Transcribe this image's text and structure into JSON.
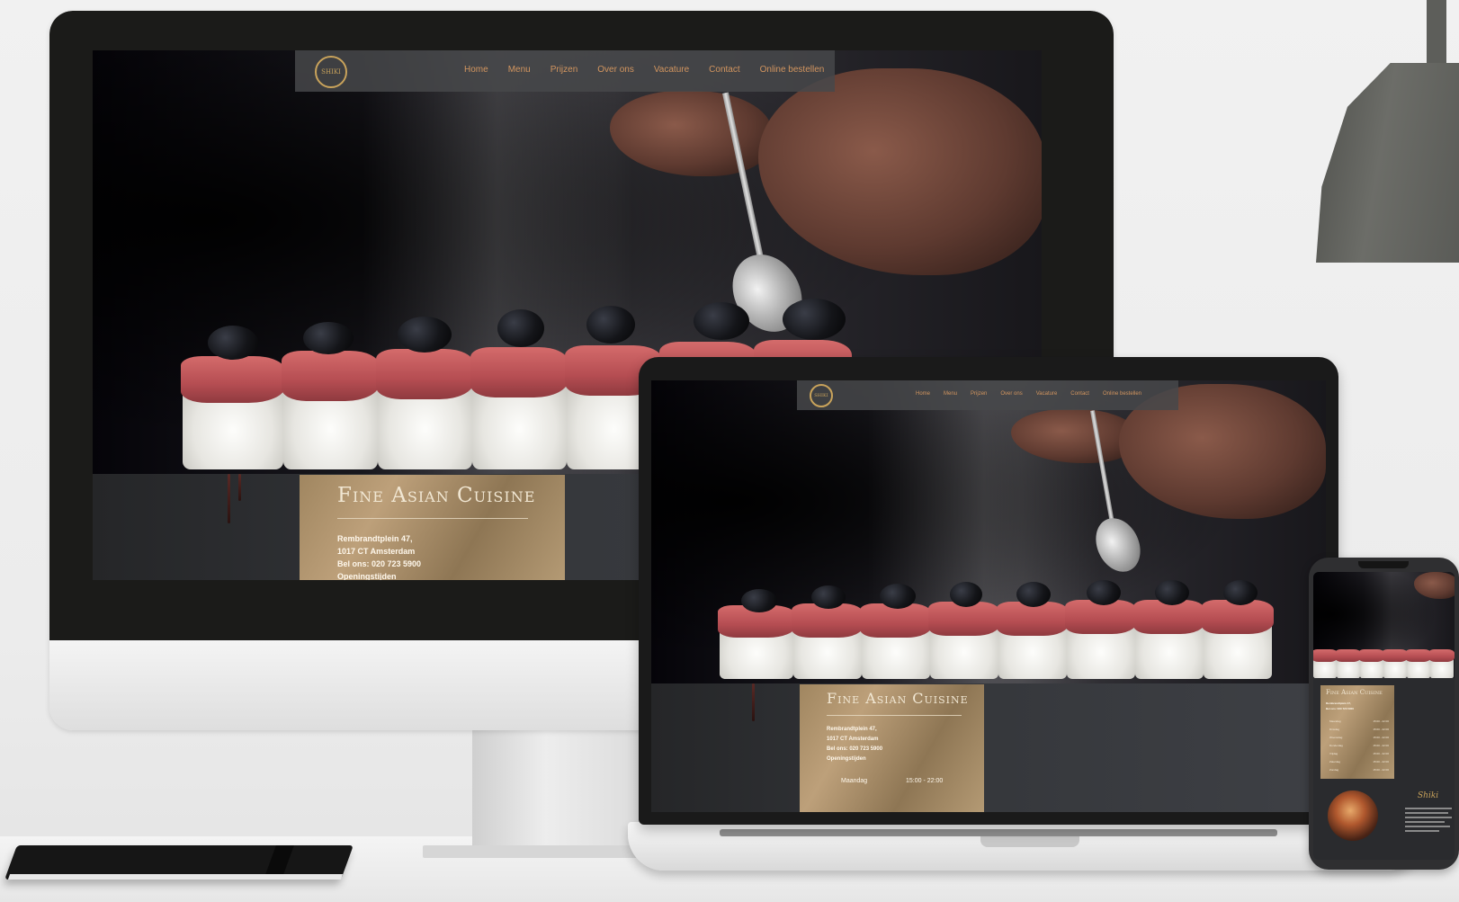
{
  "site": {
    "logo_text": "SHIKI",
    "nav": [
      "Home",
      "Menu",
      "Prijzen",
      "Over ons",
      "Vacature",
      "Contact",
      "Online bestellen"
    ],
    "card": {
      "title": "Fine Asian Cuisine",
      "address_line1": "Rembrandtplein 47,",
      "address_line2": "1017 CT Amsterdam",
      "phone": "Bel ons: 020 723 5900",
      "hours_heading": "Openingstijden",
      "hours_day": "Maandag",
      "hours_time": "15:00 - 22:00"
    },
    "phone_hours": [
      {
        "day": "Maandag",
        "time": "15:00 - 22:00"
      },
      {
        "day": "Dinsdag",
        "time": "15:00 - 22:00"
      },
      {
        "day": "Woensdag",
        "time": "15:00 - 22:00"
      },
      {
        "day": "Donderdag",
        "time": "15:00 - 22:00"
      },
      {
        "day": "Vrijdag",
        "time": "15:00 - 22:00"
      },
      {
        "day": "Zaterdag",
        "time": "15:00 - 22:00"
      },
      {
        "day": "Zondag",
        "time": "15:00 - 22:00"
      }
    ],
    "phone_script": "Shiki"
  },
  "colors": {
    "nav_text": "#d2955f",
    "gold": "#c9a35b",
    "card_gold": "#a08660"
  }
}
